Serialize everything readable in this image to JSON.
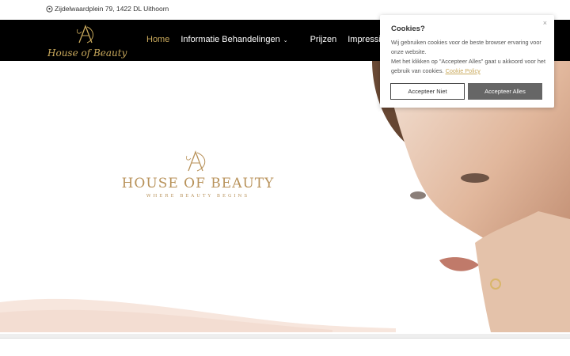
{
  "topbar": {
    "address": "Zijdelwaardplein 79,  1422 DL  Uithoorn"
  },
  "header": {
    "logo_text": "House of Beauty",
    "nav": [
      {
        "label": "Home",
        "active": true
      },
      {
        "label": "Informatie Behandelingen",
        "has_dropdown": true
      },
      {
        "label": "Prijzen"
      },
      {
        "label": "Impressie Salon"
      }
    ]
  },
  "hero": {
    "brand_title": "HOUSE OF BEAUTY",
    "brand_tagline": "WHERE BEAUTY BEGINS"
  },
  "cookie": {
    "title": "Cookies?",
    "close_label": "×",
    "text1": "Wij gebruiken cookies voor de beste browser ervaring voor onze website.",
    "text2": "Met het klikken op \"Accepteer Alles\" gaat u akkoord voor het gebruik van cookies.",
    "link": "Cookie Policy",
    "decline_label": "Accepteer Niet",
    "accept_label": "Accepteer Alles"
  },
  "colors": {
    "gold": "#c9a95c",
    "nav_bg": "#000000",
    "accept_bg": "#666666"
  },
  "icons": {
    "address": "location-pin-icon",
    "dropdown": "chevron-down-icon"
  }
}
